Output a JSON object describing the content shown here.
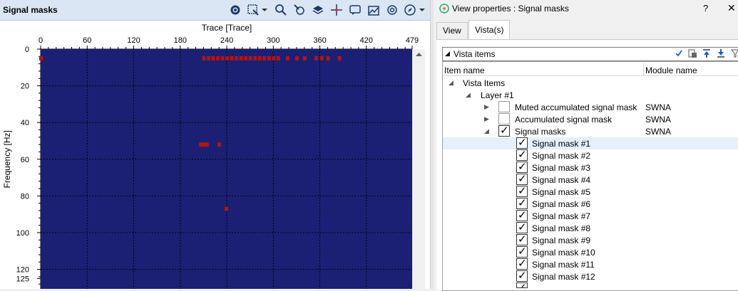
{
  "left_panel": {
    "title": "Signal masks",
    "toolbar_icons": [
      "gear-icon",
      "select-rect-icon",
      "zoom-icon",
      "pointer-icon",
      "layers-icon",
      "crosshair-icon",
      "comment-icon",
      "chart-image-icon",
      "snapshot-icon",
      "compass-icon",
      "dropdown-icon"
    ]
  },
  "chart_data": {
    "type": "heatmap",
    "title": "",
    "xlabel": "Trace [Trace]",
    "ylabel": "Frequency [Hz]",
    "x_ticks": [
      "0",
      "60",
      "120",
      "180",
      "240",
      "300",
      "360",
      "420",
      "479"
    ],
    "y_ticks": [
      "0",
      "20",
      "40",
      "60",
      "80",
      "100",
      "120",
      "125"
    ],
    "xlim": [
      0,
      479
    ],
    "ylim": [
      0,
      125
    ],
    "grid": true,
    "background_color": "#1b2075",
    "mask_color": "#b3140f",
    "mask_points": [
      {
        "trace": 0,
        "freq": 5
      },
      {
        "trace": 210,
        "freq": 5
      },
      {
        "trace": 216,
        "freq": 5
      },
      {
        "trace": 222,
        "freq": 5
      },
      {
        "trace": 228,
        "freq": 5
      },
      {
        "trace": 234,
        "freq": 5
      },
      {
        "trace": 240,
        "freq": 5
      },
      {
        "trace": 246,
        "freq": 5
      },
      {
        "trace": 252,
        "freq": 5
      },
      {
        "trace": 258,
        "freq": 5
      },
      {
        "trace": 264,
        "freq": 5
      },
      {
        "trace": 270,
        "freq": 5
      },
      {
        "trace": 276,
        "freq": 5
      },
      {
        "trace": 282,
        "freq": 5
      },
      {
        "trace": 288,
        "freq": 5
      },
      {
        "trace": 294,
        "freq": 5
      },
      {
        "trace": 300,
        "freq": 5
      },
      {
        "trace": 306,
        "freq": 5
      },
      {
        "trace": 318,
        "freq": 5
      },
      {
        "trace": 330,
        "freq": 5
      },
      {
        "trace": 340,
        "freq": 5
      },
      {
        "trace": 355,
        "freq": 5
      },
      {
        "trace": 362,
        "freq": 5
      },
      {
        "trace": 370,
        "freq": 5
      },
      {
        "trace": 385,
        "freq": 5
      },
      {
        "trace": 206,
        "freq": 52
      },
      {
        "trace": 210,
        "freq": 52
      },
      {
        "trace": 214,
        "freq": 52
      },
      {
        "trace": 230,
        "freq": 52
      },
      {
        "trace": 239,
        "freq": 87
      }
    ]
  },
  "right_panel": {
    "title": "View properties : Signal masks",
    "help": "?",
    "close": "✕",
    "tabs": [
      {
        "label": "View"
      },
      {
        "label": "Vista(s)"
      }
    ],
    "vista_header": "Vista items",
    "columns": {
      "item": "Item name",
      "module": "Module name"
    },
    "tree": [
      {
        "label": "Vista Items",
        "module": ""
      },
      {
        "label": "Layer  #1",
        "module": ""
      },
      {
        "label": "Muted accumulated signal mask",
        "module": "SWNA"
      },
      {
        "label": "Accumulated signal mask",
        "module": "SWNA"
      },
      {
        "label": "Signal masks",
        "module": "SWNA"
      },
      {
        "label": "Signal mask #1",
        "module": ""
      },
      {
        "label": "Signal mask #2",
        "module": ""
      },
      {
        "label": "Signal mask #3",
        "module": ""
      },
      {
        "label": "Signal mask #4",
        "module": ""
      },
      {
        "label": "Signal mask #5",
        "module": ""
      },
      {
        "label": "Signal mask #6",
        "module": ""
      },
      {
        "label": "Signal mask #7",
        "module": ""
      },
      {
        "label": "Signal mask #8",
        "module": ""
      },
      {
        "label": "Signal mask #9",
        "module": ""
      },
      {
        "label": "Signal mask #10",
        "module": ""
      },
      {
        "label": "Signal mask #11",
        "module": ""
      },
      {
        "label": "Signal mask #12",
        "module": ""
      }
    ]
  }
}
